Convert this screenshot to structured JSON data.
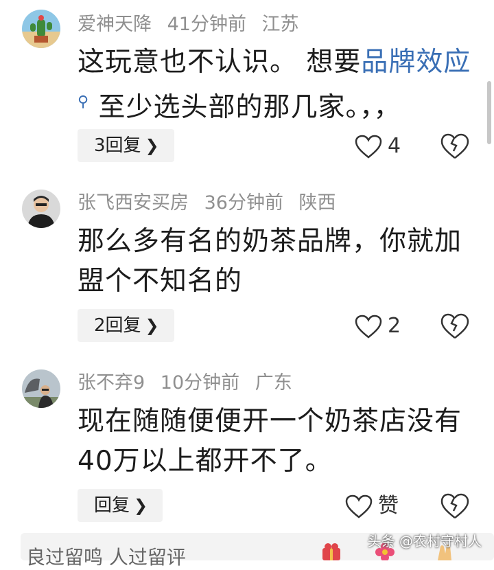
{
  "comments": [
    {
      "user": "爱神天降",
      "time": "41分钟前",
      "location": "江苏",
      "text_before": "这玩意也不认识。 想要",
      "link": "品牌效应",
      "text_after": " 至少选头部的那几家。，，",
      "reply_label": "3回复",
      "likes": "4"
    },
    {
      "user": "张飞西安买房",
      "time": "36分钟前",
      "location": "陕西",
      "text": "那么多有名的奶茶品牌，你就加盟个不知名的",
      "reply_label": "2回复",
      "likes": "2"
    },
    {
      "user": "张不弃9",
      "time": "10分钟前",
      "location": "广东",
      "text": "现在随随便便开一个奶茶店没有40万以上都开不了。",
      "reply_label": "回复",
      "likes": "赞"
    }
  ],
  "bottom_input": {
    "placeholder": "良过留鸣  人过留评"
  },
  "watermark": "头条 @农村守村人",
  "icons": [
    "chevron-right-icon",
    "heart-outline-icon",
    "broken-heart-icon",
    "gift-icon",
    "flower-icon",
    "clap-icon"
  ],
  "colors": {
    "link": "#3a6fb5",
    "meta": "#8f8f8f",
    "reply_bg": "#f2f2f2"
  }
}
